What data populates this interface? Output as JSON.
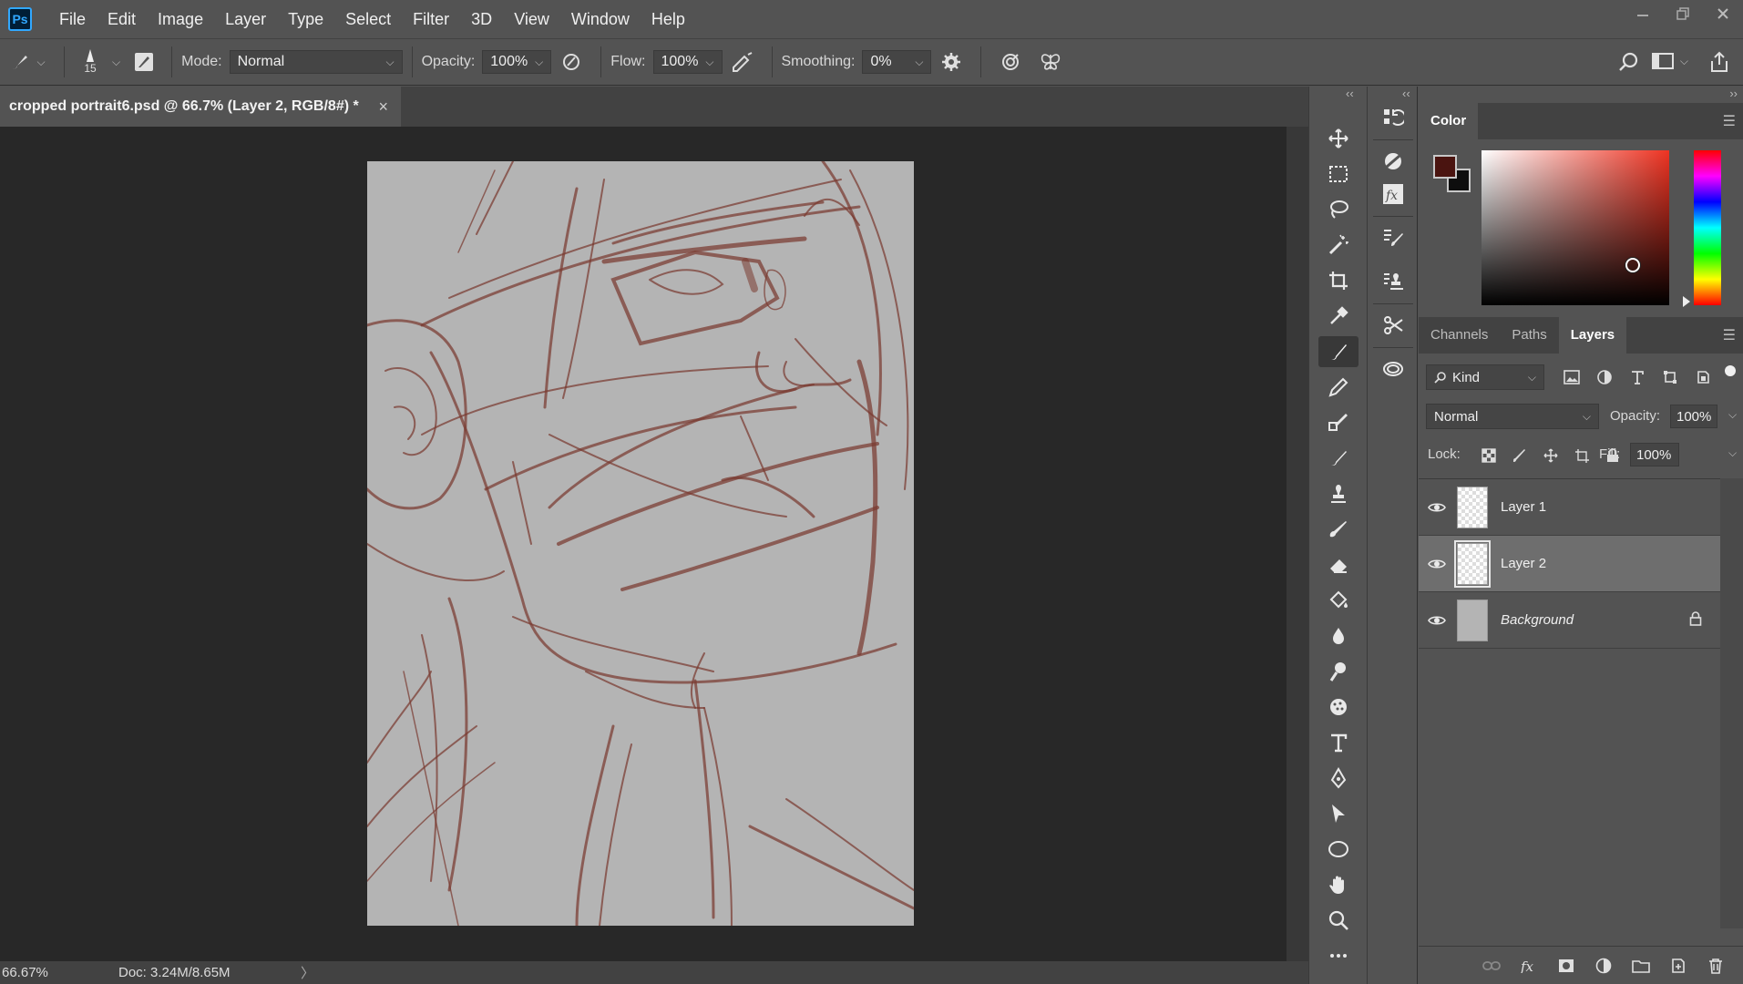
{
  "menu": {
    "logo": "Ps",
    "items": [
      "File",
      "Edit",
      "Image",
      "Layer",
      "Type",
      "Select",
      "Filter",
      "3D",
      "View",
      "Window",
      "Help"
    ]
  },
  "options": {
    "brush_size": "15",
    "mode_label": "Mode:",
    "mode_value": "Normal",
    "opacity_label": "Opacity:",
    "opacity_value": "100%",
    "flow_label": "Flow:",
    "flow_value": "100%",
    "smoothing_label": "Smoothing:",
    "smoothing_value": "0%"
  },
  "document": {
    "tab_title": "cropped portrait6.psd @ 66.7% (Layer 2, RGB/8#) *",
    "close_glyph": "×"
  },
  "status": {
    "zoom": "66.67%",
    "doc_size": "Doc: 3.24M/8.65M",
    "arrow": "〉"
  },
  "color_panel": {
    "title": "Color",
    "foreground": "#4a1410",
    "background": "#0e0e0e"
  },
  "layers_panel": {
    "tabs": [
      "Channels",
      "Paths",
      "Layers"
    ],
    "active_tab": "Layers",
    "filter_label": "Kind",
    "blend_mode": "Normal",
    "opacity_label": "Opacity:",
    "opacity_value": "100%",
    "lock_label": "Lock:",
    "fill_label": "Fill:",
    "fill_value": "100%",
    "layers": [
      {
        "name": "Layer 1",
        "selected": false
      },
      {
        "name": "Layer 2",
        "selected": true
      },
      {
        "name": "Background",
        "selected": false,
        "locked": true
      }
    ]
  },
  "colors": {
    "sketch_stroke": "#7a3a30",
    "canvas_bg": "#b4b4b4",
    "accent": "#31a8ff"
  }
}
